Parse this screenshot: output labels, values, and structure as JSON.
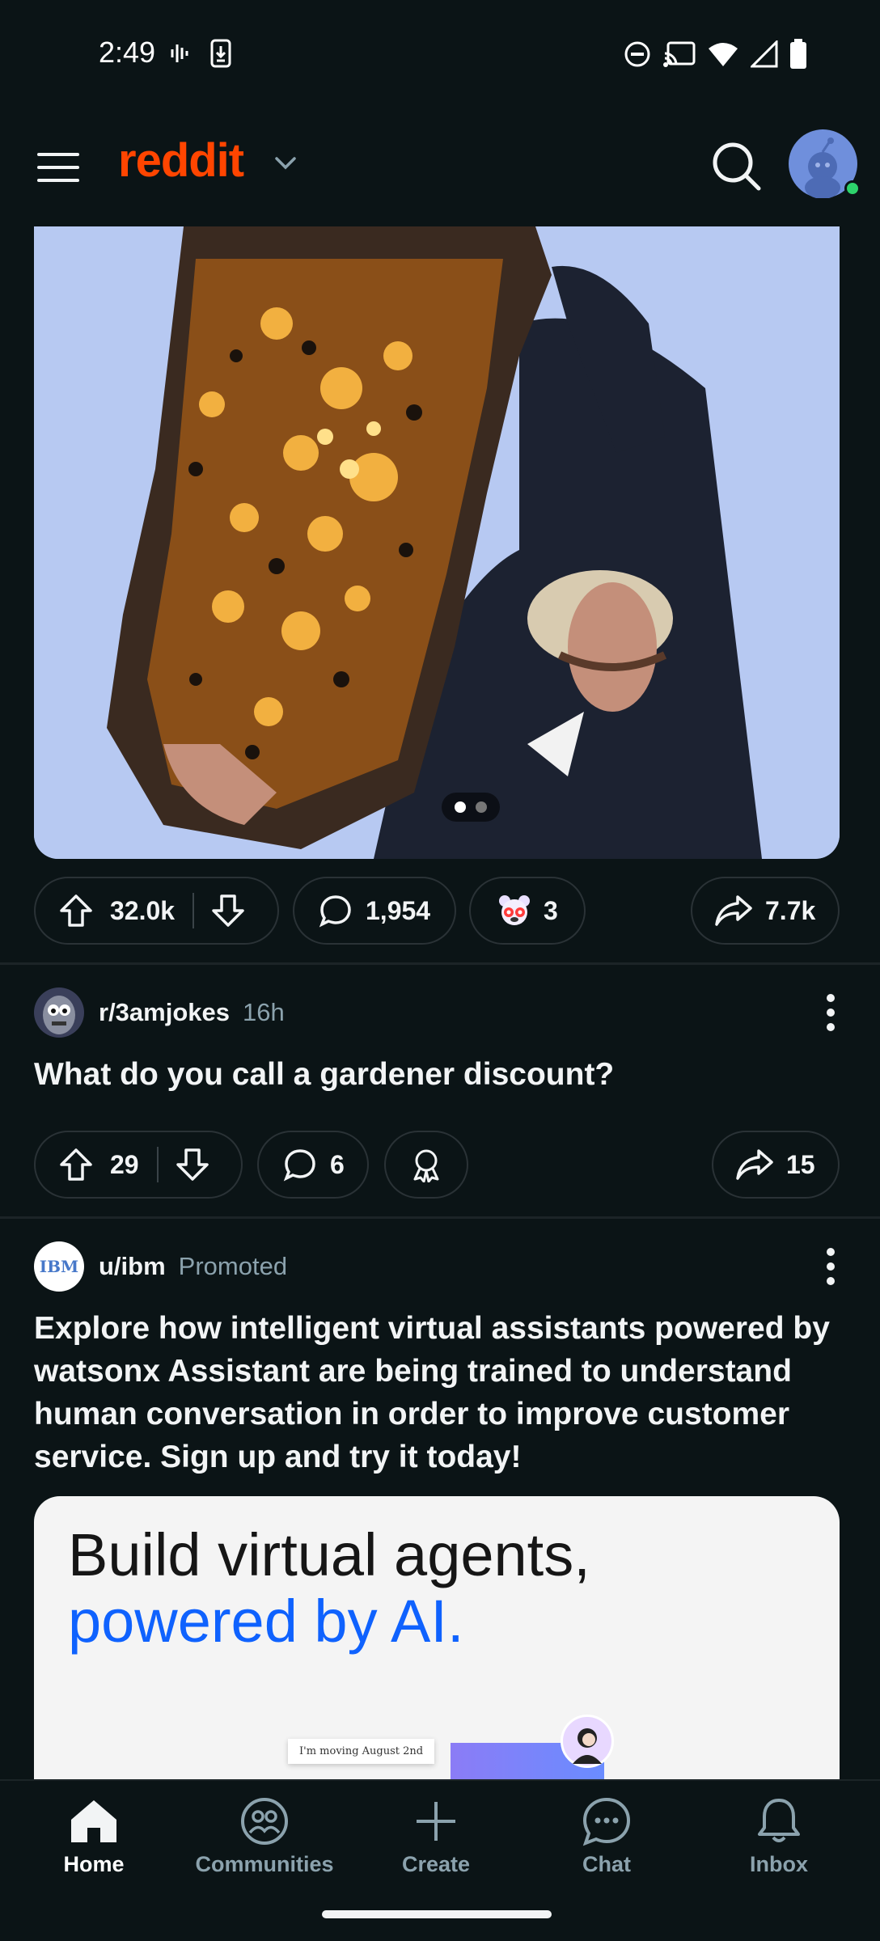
{
  "status_bar": {
    "time": "2:49",
    "left_icons": [
      "voicemail-icon",
      "download-icon"
    ],
    "right_icons": [
      "dnd-icon",
      "cast-icon",
      "wifi-icon",
      "signal-icon",
      "battery-icon"
    ]
  },
  "topbar": {
    "logo": "reddit",
    "menu_icon": "hamburger-icon",
    "search_icon": "search-icon"
  },
  "post1": {
    "image_alt": "man holding meteorite slice",
    "carousel_dots": 2,
    "carousel_active": 0,
    "upvotes": "32.0k",
    "comments": "1,954",
    "awards": "3",
    "shares": "7.7k"
  },
  "post2": {
    "subreddit": "r/3amjokes",
    "age": "16h",
    "title": "What do you call a gardener discount?",
    "upvotes": "29",
    "comments": "6",
    "shares": "15"
  },
  "post3": {
    "author": "u/ibm",
    "label": "Promoted",
    "avatar_text": "IBM",
    "title": "Explore how intelligent virtual assistants powered by watsonx Assistant are being trained to understand human conversation in order to improve customer service. Sign up and try it today!",
    "ad_headline_1": "Build virtual agents,",
    "ad_headline_2": "powered by AI.",
    "ad_bubble": "I'm moving August 2nd"
  },
  "bottom_nav": {
    "items": [
      {
        "label": "Home",
        "icon": "home-icon",
        "active": true
      },
      {
        "label": "Communities",
        "icon": "communities-icon",
        "active": false
      },
      {
        "label": "Create",
        "icon": "plus-icon",
        "active": false
      },
      {
        "label": "Chat",
        "icon": "chat-icon",
        "active": false
      },
      {
        "label": "Inbox",
        "icon": "bell-icon",
        "active": false
      }
    ]
  },
  "colors": {
    "background": "#0b1416",
    "brand": "#ff4500",
    "text": "#f2f4f5",
    "meta": "#8ba2ad",
    "online": "#2dd36b",
    "ad_blue": "#0f62fe"
  }
}
